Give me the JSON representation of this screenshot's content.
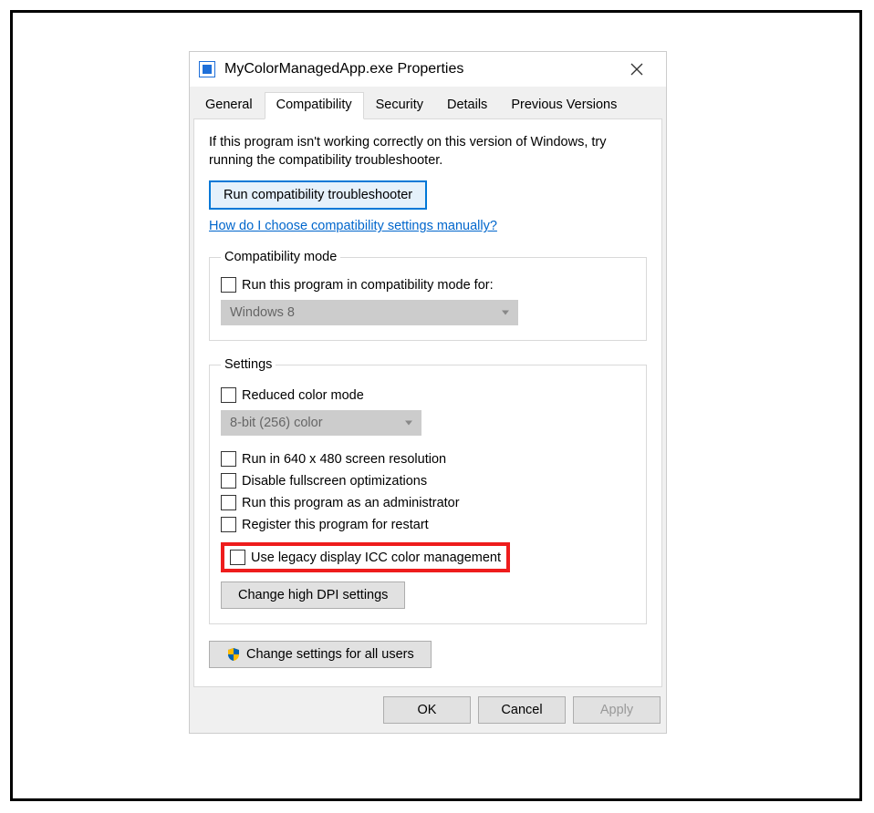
{
  "window": {
    "title": "MyColorManagedApp.exe Properties"
  },
  "tabs": {
    "items": [
      "General",
      "Compatibility",
      "Security",
      "Details",
      "Previous Versions"
    ],
    "active_index": 1
  },
  "intro": "If this program isn't working correctly on this version of Windows, try running the compatibility troubleshooter.",
  "troubleshooter_button": "Run compatibility troubleshooter",
  "help_link": "How do I choose compatibility settings manually?",
  "compat_group": {
    "legend": "Compatibility mode",
    "checkbox_label": "Run this program in compatibility mode for:",
    "select_value": "Windows 8"
  },
  "settings_group": {
    "legend": "Settings",
    "reduced_color_label": "Reduced color mode",
    "reduced_color_select": "8-bit (256) color",
    "resolution_label": "Run in 640 x 480 screen resolution",
    "disable_fullscreen_label": "Disable fullscreen optimizations",
    "admin_label": "Run this program as an administrator",
    "register_restart_label": "Register this program for restart",
    "legacy_icc_label": "Use legacy display ICC color management",
    "dpi_button": "Change high DPI settings"
  },
  "all_users_button": "Change settings for all users",
  "buttons": {
    "ok": "OK",
    "cancel": "Cancel",
    "apply": "Apply"
  },
  "icons": {
    "app": "app-icon",
    "close": "close-icon",
    "shield": "uac-shield-icon"
  },
  "highlight": {
    "target": "legacy-icc-checkbox",
    "color": "#ee1c1c"
  }
}
